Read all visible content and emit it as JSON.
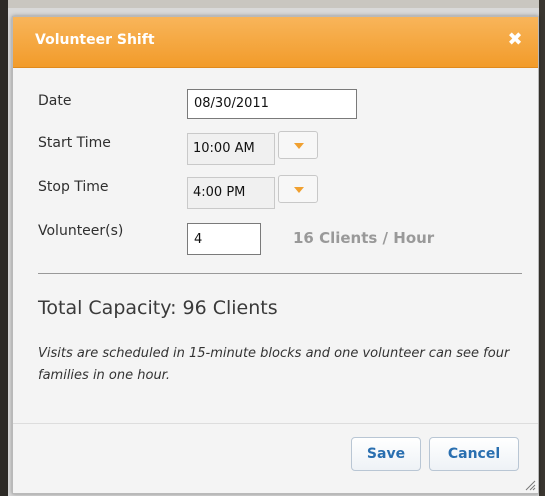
{
  "dialog": {
    "title": "Volunteer Shift",
    "close_icon": "close-icon",
    "close_glyph": "✖"
  },
  "form": {
    "date": {
      "label": "Date",
      "value": "08/30/2011"
    },
    "start_time": {
      "label": "Start Time",
      "value": "10:00 AM"
    },
    "stop_time": {
      "label": "Stop Time",
      "value": "4:00 PM"
    },
    "volunteers": {
      "label": "Volunteer(s)",
      "value": "4"
    },
    "rate_text": "16 Clients / Hour"
  },
  "summary": {
    "capacity": "Total Capacity: 96 Clients",
    "note": "Visits are scheduled in 15-minute blocks and one volunteer can see four families in one hour."
  },
  "buttons": {
    "save": "Save",
    "cancel": "Cancel"
  },
  "colors": {
    "accent": "#f29b2a",
    "link": "#2a6fb0",
    "muted": "#999999"
  }
}
